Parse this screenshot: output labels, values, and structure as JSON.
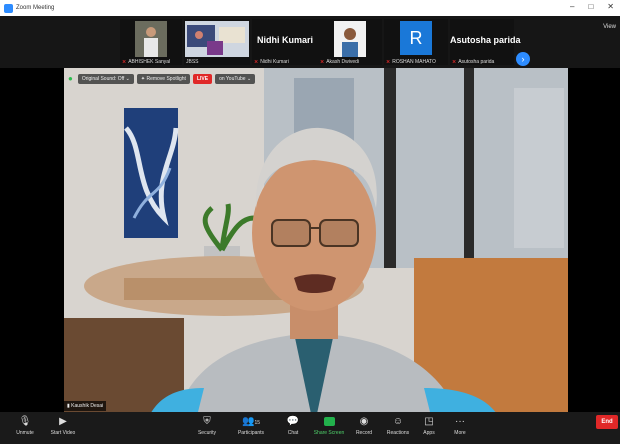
{
  "window": {
    "title": "Zoom Meeting",
    "controls": [
      "–",
      "□",
      "✕"
    ]
  },
  "gallery": {
    "tiles": [
      {
        "name": "ABHISHEK Sanyal",
        "muted": true
      },
      {
        "name": "JBSS",
        "muted": false
      },
      {
        "name": "Nidhi Kumari",
        "display_name": "Nidhi Kumari",
        "muted": true
      },
      {
        "name": "Akash Dwivedi",
        "muted": true
      },
      {
        "name": "ROSHAN MAHATO",
        "avatar_letter": "R",
        "muted": true
      },
      {
        "name": "Asutosha parida",
        "display_name": "Asutosha parida",
        "muted": true
      }
    ],
    "next_icon": "›",
    "view_label": "View"
  },
  "overlay": {
    "original_sound": "Original Sound: Off",
    "original_sound_caret": "⌄",
    "remove_spotlight": "Remove Spotlight",
    "live": "LIVE",
    "live_platform": "on YouTube",
    "live_caret": "⌄"
  },
  "speaker": {
    "name": "Kaushik Desai"
  },
  "toolbar": {
    "unmute": "Unmute",
    "start_video": "Start Video",
    "security": "Security",
    "participants": "Participants",
    "participants_count": "15",
    "chat": "Chat",
    "share_screen": "Share Screen",
    "record": "Record",
    "reactions": "Reactions",
    "apps": "Apps",
    "more": "More",
    "end": "End"
  },
  "colors": {
    "brand": "#2d8cff",
    "end": "#e02828",
    "share": "#22b14c",
    "live": "#e02828"
  }
}
